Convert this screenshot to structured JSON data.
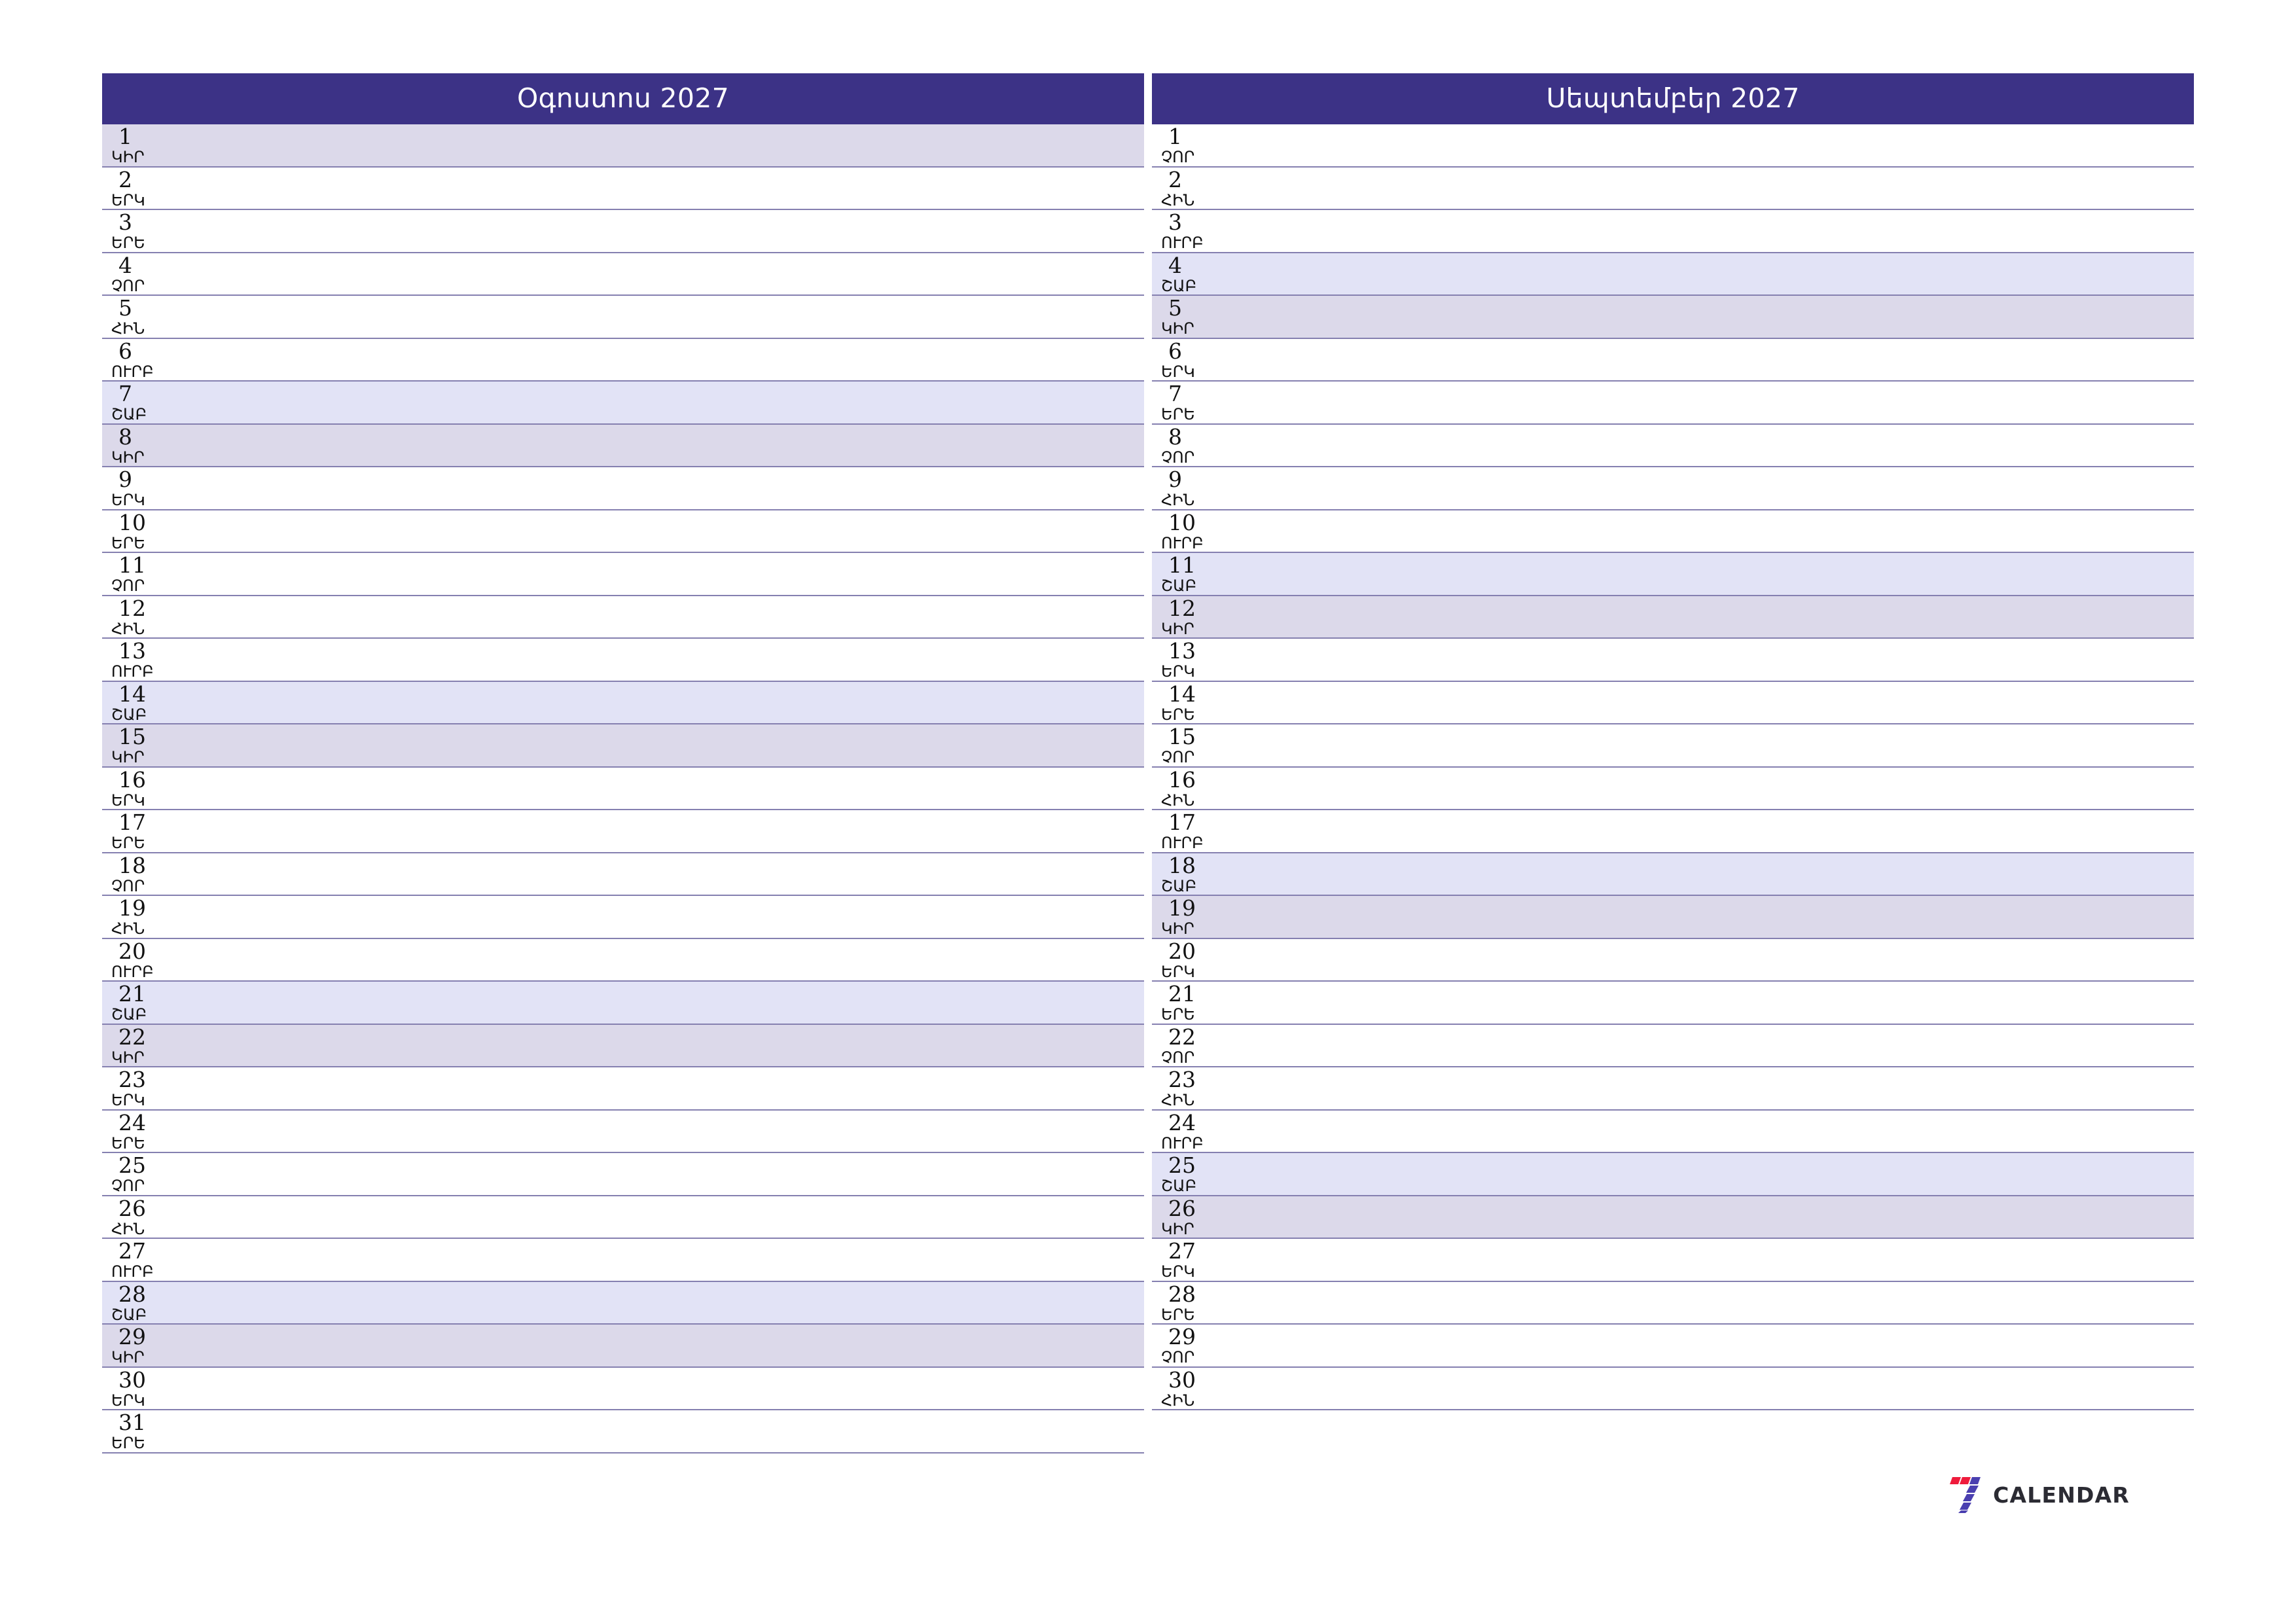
{
  "document": {
    "type": "printable-monthly-planner",
    "year": "2027",
    "language": "hy"
  },
  "theme": {
    "header_bg": "#3c3286",
    "header_text": "#ffffff",
    "border": "#8580b0",
    "saturday_bg": "#e2e3f6",
    "sunday_bg": "#dcd9ea",
    "page_bg": "#ffffff",
    "text": "#111111",
    "logo_red": "#ef1b3c",
    "logo_blue": "#4a3fb0",
    "logo_word": "#2b2b33"
  },
  "weekday_names": {
    "sun": "ԿԻՐ",
    "mon": "ԵՐԿ",
    "tue": "ԵՐԵ",
    "wed": "ՉՈՐ",
    "thu": "ՀԻՆ",
    "fri": "ՈՒՐԲ",
    "sat": "ՇԱԲ"
  },
  "months": [
    {
      "title": "Օգոստոս 2027",
      "days": [
        {
          "num": "1",
          "name": "ԿԻՐ",
          "kind": "sun"
        },
        {
          "num": "2",
          "name": "ԵՐԿ",
          "kind": "wd"
        },
        {
          "num": "3",
          "name": "ԵՐԵ",
          "kind": "wd"
        },
        {
          "num": "4",
          "name": "ՉՈՐ",
          "kind": "wd"
        },
        {
          "num": "5",
          "name": "ՀԻՆ",
          "kind": "wd"
        },
        {
          "num": "6",
          "name": "ՈՒՐԲ",
          "kind": "wd"
        },
        {
          "num": "7",
          "name": "ՇԱԲ",
          "kind": "sat"
        },
        {
          "num": "8",
          "name": "ԿԻՐ",
          "kind": "sun"
        },
        {
          "num": "9",
          "name": "ԵՐԿ",
          "kind": "wd"
        },
        {
          "num": "10",
          "name": "ԵՐԵ",
          "kind": "wd"
        },
        {
          "num": "11",
          "name": "ՉՈՐ",
          "kind": "wd"
        },
        {
          "num": "12",
          "name": "ՀԻՆ",
          "kind": "wd"
        },
        {
          "num": "13",
          "name": "ՈՒՐԲ",
          "kind": "wd"
        },
        {
          "num": "14",
          "name": "ՇԱԲ",
          "kind": "sat"
        },
        {
          "num": "15",
          "name": "ԿԻՐ",
          "kind": "sun"
        },
        {
          "num": "16",
          "name": "ԵՐԿ",
          "kind": "wd"
        },
        {
          "num": "17",
          "name": "ԵՐԵ",
          "kind": "wd"
        },
        {
          "num": "18",
          "name": "ՉՈՐ",
          "kind": "wd"
        },
        {
          "num": "19",
          "name": "ՀԻՆ",
          "kind": "wd"
        },
        {
          "num": "20",
          "name": "ՈՒՐԲ",
          "kind": "wd"
        },
        {
          "num": "21",
          "name": "ՇԱԲ",
          "kind": "sat"
        },
        {
          "num": "22",
          "name": "ԿԻՐ",
          "kind": "sun"
        },
        {
          "num": "23",
          "name": "ԵՐԿ",
          "kind": "wd"
        },
        {
          "num": "24",
          "name": "ԵՐԵ",
          "kind": "wd"
        },
        {
          "num": "25",
          "name": "ՉՈՐ",
          "kind": "wd"
        },
        {
          "num": "26",
          "name": "ՀԻՆ",
          "kind": "wd"
        },
        {
          "num": "27",
          "name": "ՈՒՐԲ",
          "kind": "wd"
        },
        {
          "num": "28",
          "name": "ՇԱԲ",
          "kind": "sat"
        },
        {
          "num": "29",
          "name": "ԿԻՐ",
          "kind": "sun"
        },
        {
          "num": "30",
          "name": "ԵՐԿ",
          "kind": "wd"
        },
        {
          "num": "31",
          "name": "ԵՐԵ",
          "kind": "wd"
        }
      ]
    },
    {
      "title": "Սեպտեմբեր 2027",
      "days": [
        {
          "num": "1",
          "name": "ՉՈՐ",
          "kind": "wd"
        },
        {
          "num": "2",
          "name": "ՀԻՆ",
          "kind": "wd"
        },
        {
          "num": "3",
          "name": "ՈՒՐԲ",
          "kind": "wd"
        },
        {
          "num": "4",
          "name": "ՇԱԲ",
          "kind": "sat"
        },
        {
          "num": "5",
          "name": "ԿԻՐ",
          "kind": "sun"
        },
        {
          "num": "6",
          "name": "ԵՐԿ",
          "kind": "wd"
        },
        {
          "num": "7",
          "name": "ԵՐԵ",
          "kind": "wd"
        },
        {
          "num": "8",
          "name": "ՉՈՐ",
          "kind": "wd"
        },
        {
          "num": "9",
          "name": "ՀԻՆ",
          "kind": "wd"
        },
        {
          "num": "10",
          "name": "ՈՒՐԲ",
          "kind": "wd"
        },
        {
          "num": "11",
          "name": "ՇԱԲ",
          "kind": "sat"
        },
        {
          "num": "12",
          "name": "ԿԻՐ",
          "kind": "sun"
        },
        {
          "num": "13",
          "name": "ԵՐԿ",
          "kind": "wd"
        },
        {
          "num": "14",
          "name": "ԵՐԵ",
          "kind": "wd"
        },
        {
          "num": "15",
          "name": "ՉՈՐ",
          "kind": "wd"
        },
        {
          "num": "16",
          "name": "ՀԻՆ",
          "kind": "wd"
        },
        {
          "num": "17",
          "name": "ՈՒՐԲ",
          "kind": "wd"
        },
        {
          "num": "18",
          "name": "ՇԱԲ",
          "kind": "sat"
        },
        {
          "num": "19",
          "name": "ԿԻՐ",
          "kind": "sun"
        },
        {
          "num": "20",
          "name": "ԵՐԿ",
          "kind": "wd"
        },
        {
          "num": "21",
          "name": "ԵՐԵ",
          "kind": "wd"
        },
        {
          "num": "22",
          "name": "ՉՈՐ",
          "kind": "wd"
        },
        {
          "num": "23",
          "name": "ՀԻՆ",
          "kind": "wd"
        },
        {
          "num": "24",
          "name": "ՈՒՐԲ",
          "kind": "wd"
        },
        {
          "num": "25",
          "name": "ՇԱԲ",
          "kind": "sat"
        },
        {
          "num": "26",
          "name": "ԿԻՐ",
          "kind": "sun"
        },
        {
          "num": "27",
          "name": "ԵՐԿ",
          "kind": "wd"
        },
        {
          "num": "28",
          "name": "ԵՐԵ",
          "kind": "wd"
        },
        {
          "num": "29",
          "name": "ՉՈՐ",
          "kind": "wd"
        },
        {
          "num": "30",
          "name": "ՀԻՆ",
          "kind": "wd"
        }
      ]
    }
  ],
  "logo": {
    "icon": "seven-stripes-mark",
    "word": "CALENDAR"
  }
}
